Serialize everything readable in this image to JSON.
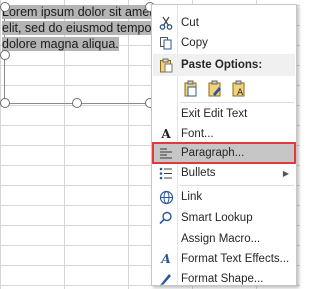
{
  "textbox": {
    "lines": [
      "Lorem ipsum dolor sit amet,",
      "elit, sed do eiusmod tempor",
      "dolore magna aliqua."
    ]
  },
  "menu": {
    "cut": "Cut",
    "copy": "Copy",
    "paste_options": "Paste Options:",
    "exit_edit_text": "Exit Edit Text",
    "font": "Font...",
    "paragraph": "Paragraph...",
    "bullets": "Bullets",
    "link": "Link",
    "smart_lookup": "Smart Lookup",
    "assign_macro": "Assign Macro...",
    "format_text_effects": "Format Text Effects...",
    "format_shape": "Format Shape..."
  },
  "colors": {
    "accent": "#2b579a",
    "highlight_border": "#e23a3a",
    "highlight_bg": "#c6c6c6"
  }
}
